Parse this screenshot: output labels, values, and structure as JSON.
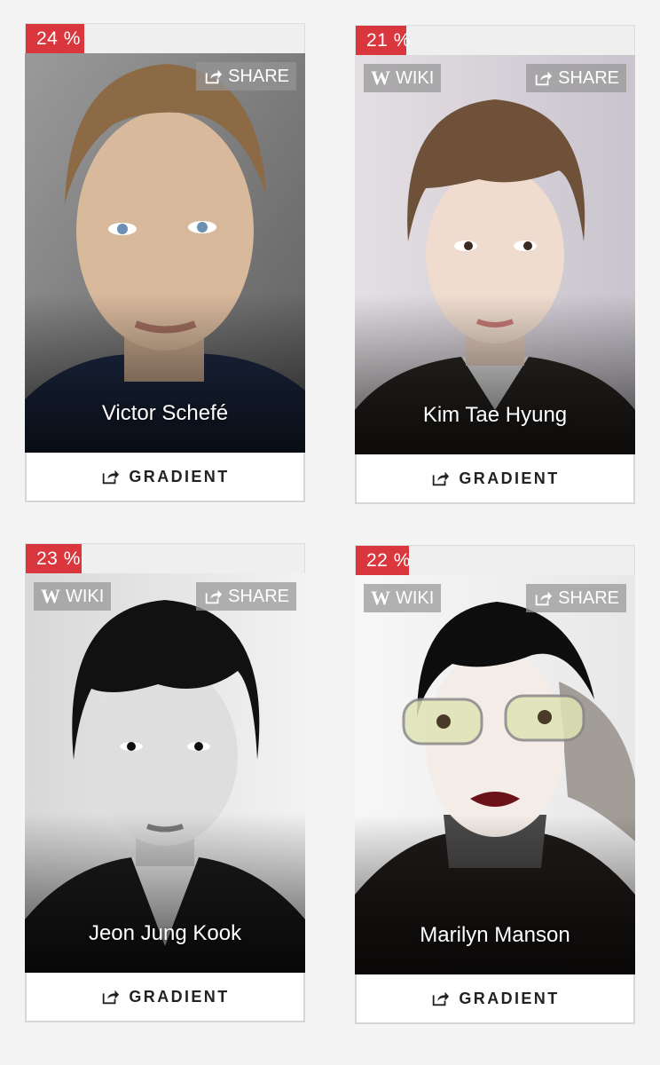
{
  "cards": [
    {
      "percent": "24 %",
      "percent_value": 24,
      "name": "Victor Schefé",
      "share_label": "SHARE",
      "wiki_label": null,
      "button_label": "GRADIENT"
    },
    {
      "percent": "21 %",
      "percent_value": 21,
      "name": "Kim Tae Hyung",
      "share_label": "SHARE",
      "wiki_label": "WIKI",
      "button_label": "GRADIENT"
    },
    {
      "percent": "23 %",
      "percent_value": 23,
      "name": "Jeon Jung Kook",
      "share_label": "SHARE",
      "wiki_label": "WIKI",
      "button_label": "GRADIENT"
    },
    {
      "percent": "22 %",
      "percent_value": 22,
      "name": "Marilyn Manson",
      "share_label": "SHARE",
      "wiki_label": "WIKI",
      "button_label": "GRADIENT"
    }
  ],
  "colors": {
    "accent": "#d9363e",
    "tag_bg": "#969696",
    "button_border": "#d6d6d6"
  },
  "icons": {
    "share": "share-icon",
    "wiki": "wikipedia-icon"
  }
}
